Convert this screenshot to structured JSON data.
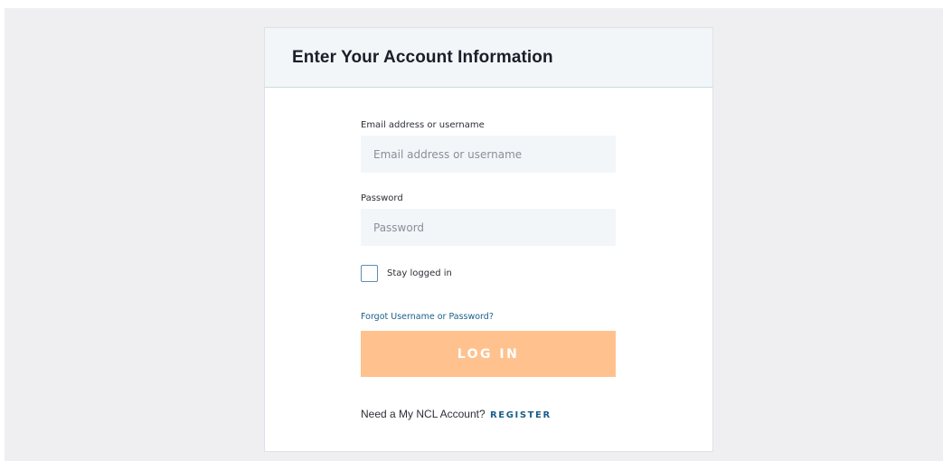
{
  "card": {
    "title": "Enter Your Account Information"
  },
  "form": {
    "email_label": "Email address or username",
    "email_placeholder": "Email address or username",
    "email_value": "",
    "password_label": "Password",
    "password_placeholder": "Password",
    "password_value": "",
    "stay_logged_in_label": "Stay logged in",
    "stay_logged_in_checked": false,
    "forgot_link": "Forgot Username or Password?",
    "login_button": "LOG IN",
    "register_prompt": "Need a My NCL Account?",
    "register_link": "REGISTER"
  },
  "colors": {
    "page_background": "#efeff2",
    "header_background": "#f3f6f9",
    "input_background": "#f3f6f9",
    "login_button": "#ffc28e",
    "link": "#1b5f8a",
    "checkbox_border": "#5a8fb8"
  }
}
